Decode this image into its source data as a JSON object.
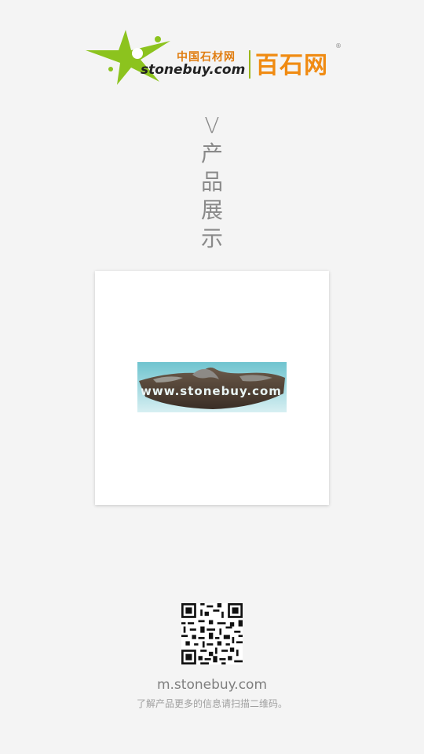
{
  "logo": {
    "cn_small": "中国石材网",
    "domain": "stonebuy.com",
    "brand": "百石网",
    "registered": "®"
  },
  "section_title": [
    "V",
    "产",
    "品",
    "展",
    "示"
  ],
  "product_image": {
    "watermark": "www.stonebuy.com"
  },
  "footer": {
    "url": "m.stonebuy.com",
    "hint": "了解产品更多的信息请扫描二维码。"
  }
}
